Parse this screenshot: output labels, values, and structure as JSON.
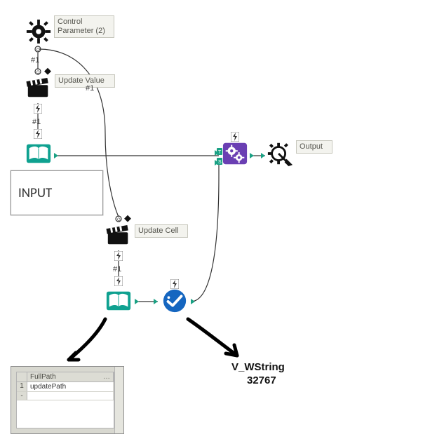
{
  "labels": {
    "control_param": "Control Parameter (2)",
    "update_value": "Update Value",
    "update_cell": "Update Cell",
    "output": "Output",
    "input_box": "INPUT"
  },
  "tags": {
    "cp_out": "#1",
    "uv_in": "#1",
    "uv_out": "#1",
    "uc_out": "#1"
  },
  "annotations": {
    "type_name": "V_WString",
    "type_size": "32767"
  },
  "results": {
    "columns": [
      "FullPath"
    ],
    "rows": [
      {
        "idx": "1",
        "values": [
          "updatePath"
        ]
      },
      {
        "idx": "-",
        "values": [
          ""
        ]
      }
    ]
  },
  "chart_data": {
    "type": "diagram",
    "description": "Alteryx-style macro workflow",
    "nodes": [
      {
        "id": "control_param",
        "kind": "Control Parameter",
        "label": "Control Parameter (2)",
        "pos": [
          40,
          44
        ],
        "anchors": {
          "out": "#1"
        }
      },
      {
        "id": "update_value",
        "kind": "Action",
        "label": "Update Value",
        "pos": [
          40,
          118
        ],
        "anchors": {
          "in": "#1",
          "out": "#1"
        }
      },
      {
        "id": "input_1",
        "kind": "Macro Input",
        "label": "INPUT",
        "pos": [
          40,
          208
        ]
      },
      {
        "id": "update_cell",
        "kind": "Action",
        "label": "Update Cell",
        "pos": [
          154,
          326
        ]
      },
      {
        "id": "input_2",
        "kind": "Macro Input",
        "label": "",
        "pos": [
          154,
          416
        ]
      },
      {
        "id": "select",
        "kind": "Select",
        "label": "",
        "pos": [
          234,
          416
        ]
      },
      {
        "id": "dyn_replace",
        "kind": "Dynamic Replace",
        "label": "",
        "pos": [
          316,
          208
        ]
      },
      {
        "id": "macro_output",
        "kind": "Macro Output",
        "label": "Output",
        "pos": [
          384,
          208
        ]
      }
    ],
    "edges": [
      {
        "from": "control_param",
        "from_anchor": "#1",
        "to": "update_value",
        "to_anchor": "in"
      },
      {
        "from": "control_param",
        "from_anchor": "#1",
        "to": "update_cell",
        "to_anchor": "in"
      },
      {
        "from": "update_value",
        "from_anchor": "#1",
        "to": "input_1",
        "to_anchor": "action"
      },
      {
        "from": "update_cell",
        "from_anchor": "#1",
        "to": "input_2",
        "to_anchor": "action"
      },
      {
        "from": "input_1",
        "from_anchor": "out",
        "to": "dyn_replace",
        "to_anchor": "in_top"
      },
      {
        "from": "input_2",
        "from_anchor": "out",
        "to": "select",
        "to_anchor": "in"
      },
      {
        "from": "select",
        "from_anchor": "out",
        "to": "dyn_replace",
        "to_anchor": "in_bottom"
      },
      {
        "from": "dyn_replace",
        "from_anchor": "out",
        "to": "macro_output",
        "to_anchor": "in"
      }
    ],
    "annotations": [
      {
        "target": "select",
        "text": "V_WString 32767"
      },
      {
        "target": "input_2",
        "results_preview": {
          "columns": [
            "FullPath"
          ],
          "rows": [
            [
              "updatePath"
            ]
          ]
        }
      }
    ]
  }
}
